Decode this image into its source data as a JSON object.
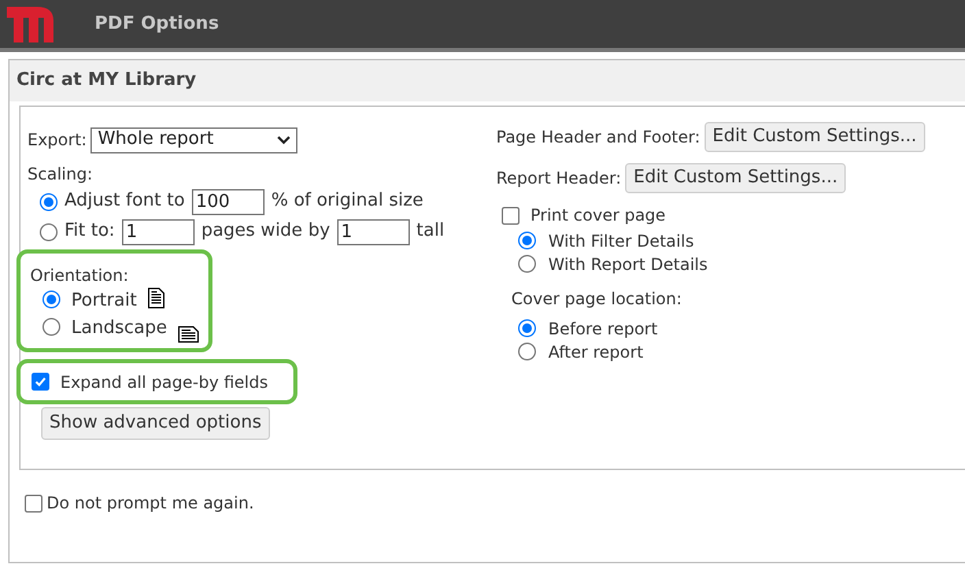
{
  "app_bar": {
    "title": "PDF Options"
  },
  "dialog": {
    "title": "Circ at MY Library",
    "export": {
      "label": "Export:",
      "value": "Whole report"
    },
    "scaling": {
      "label": "Scaling:",
      "options": [
        {
          "selected": true,
          "parts": [
            {
              "kind": "text",
              "text": "Adjust font to"
            },
            {
              "kind": "field",
              "value": "100"
            },
            {
              "kind": "text",
              "text": "% of original size"
            }
          ]
        },
        {
          "selected": false,
          "parts": [
            {
              "kind": "text",
              "text": "Fit to:"
            },
            {
              "kind": "field",
              "value": "1"
            },
            {
              "kind": "text",
              "text": "pages wide by"
            },
            {
              "kind": "field",
              "value": "1"
            },
            {
              "kind": "text",
              "text": "tall"
            }
          ]
        }
      ]
    },
    "orientation": {
      "label": "Orientation:",
      "highlighted": true,
      "options": [
        {
          "label": "Portrait",
          "selected": true,
          "kind": "portrait"
        },
        {
          "label": "Landscape",
          "selected": false,
          "kind": "landscape"
        }
      ]
    },
    "expand_page_by": {
      "label": "Expand all page-by fields",
      "checked": true,
      "highlighted": true
    },
    "advanced_button": "Show advanced options",
    "page_header_footer": {
      "label": "Page Header and Footer:",
      "button": "Edit Custom Settings..."
    },
    "report_header": {
      "label": "Report Header:",
      "button": "Edit Custom Settings..."
    },
    "print_cover_page": {
      "label": "Print cover page",
      "checked": false
    },
    "cover_details": [
      {
        "label": "With Filter Details",
        "selected": true
      },
      {
        "label": "With Report Details",
        "selected": false
      }
    ],
    "cover_location": {
      "label": "Cover page location:",
      "options": [
        {
          "label": "Before report",
          "selected": true
        },
        {
          "label": "After report",
          "selected": false
        }
      ]
    },
    "do_not_prompt": {
      "label": "Do not prompt me again.",
      "checked": false
    }
  }
}
